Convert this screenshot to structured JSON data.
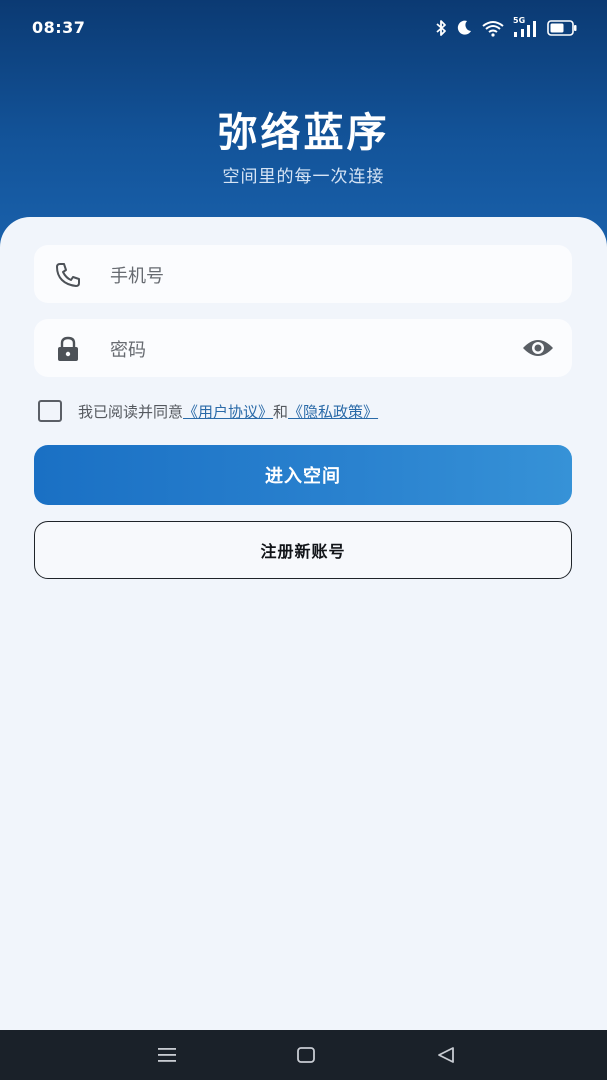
{
  "status_bar": {
    "time": "08:37",
    "icons": [
      "bluetooth-icon",
      "moon-icon",
      "wifi-icon",
      "cellular-5g-icon",
      "battery-icon"
    ],
    "network_label": "5G"
  },
  "header": {
    "title": "弥络蓝序",
    "subtitle": "空间里的每一次连接"
  },
  "form": {
    "phone": {
      "placeholder": "手机号",
      "icon": "phone-icon"
    },
    "password": {
      "placeholder": "密码",
      "icon": "lock-icon",
      "toggle_icon": "eye-icon"
    },
    "agreement": {
      "checked": false,
      "prefix": "我已阅读并同意",
      "user_agreement_link": "《用户协议》",
      "conjunction": "和",
      "privacy_policy_link": "《隐私政策》"
    },
    "login_button": "进入空间",
    "register_button": "注册新账号"
  },
  "nav_bar": {
    "icons": [
      "menu-icon",
      "home-icon",
      "back-icon"
    ]
  },
  "colors": {
    "header_top": "#0b3a73",
    "header_bottom": "#1a62ad",
    "primary_button": "#2a82cf",
    "link": "#2a6aa8",
    "background": "#f1f5fb",
    "nav_bar": "#1a2129"
  }
}
